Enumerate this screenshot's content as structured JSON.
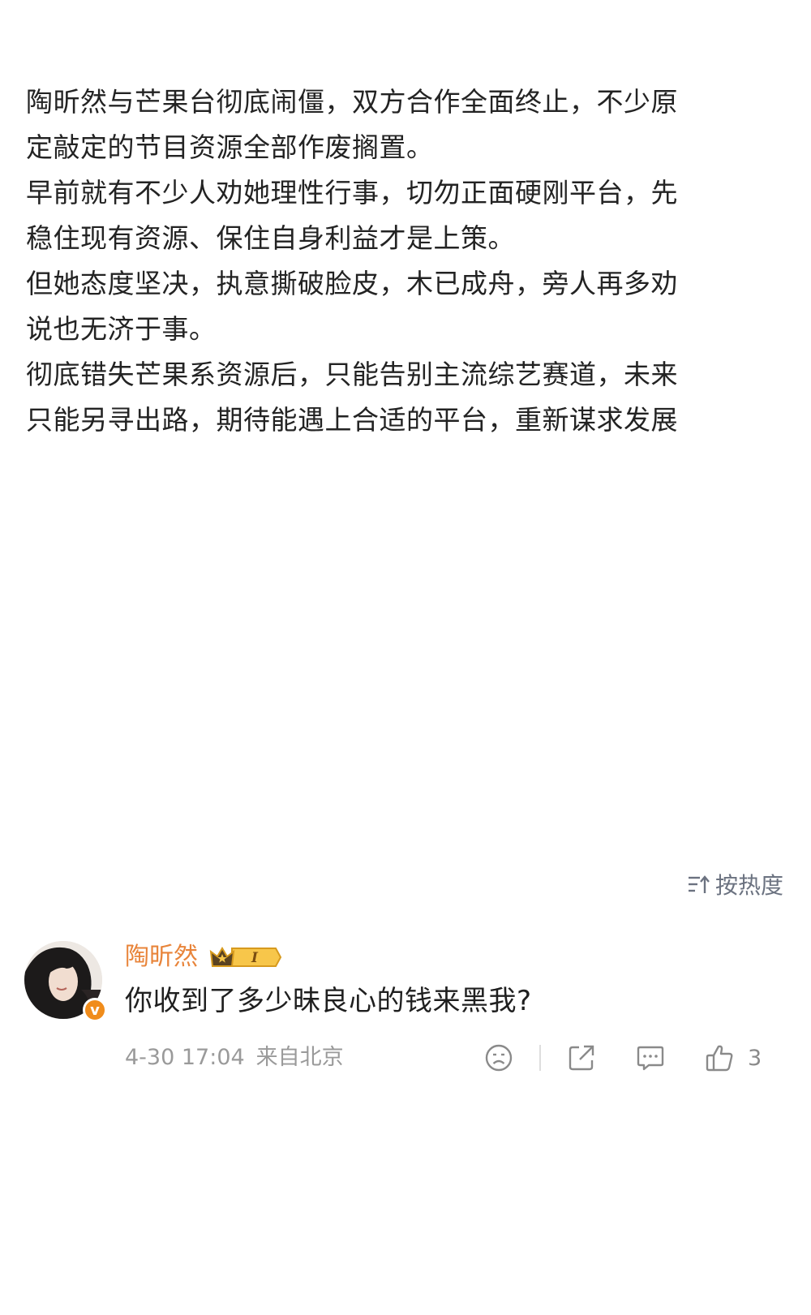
{
  "post": {
    "lines": [
      "陶昕然与芒果台彻底闹僵，双方合作全面终止，不少原",
      "定敲定的节目资源全部作废搁置。",
      "早前就有不少人劝她理性行事，切勿正面硬刚平台，先",
      "稳住现有资源、保住自身利益才是上策。",
      "但她态度坚决，执意撕破脸皮，木已成舟，旁人再多劝",
      "说也无济于事。",
      "彻底错失芒果系资源后，只能告别主流综艺赛道，未来",
      "只能另寻出路，期待能遇上合适的平台，重新谋求发展"
    ]
  },
  "sort": {
    "label": "按热度",
    "icon": "sort-icon"
  },
  "comment": {
    "username": "陶昕然",
    "badge_text": "I",
    "text": "你收到了多少昧良心的钱来黑我?",
    "timestamp": "4-30 17:04",
    "location": "来自北京",
    "like_count": "3",
    "verified_mark": "v",
    "colors": {
      "username": "#e8843a",
      "verified": "#f08c1b",
      "badge": "#f2b233"
    }
  }
}
